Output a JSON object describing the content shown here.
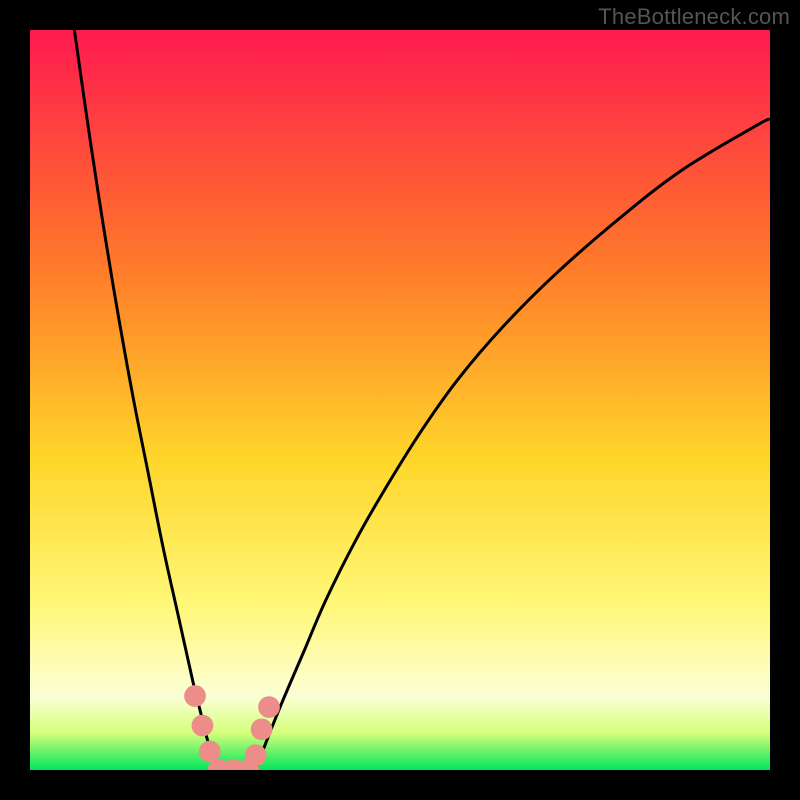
{
  "watermark": "TheBottleneck.com",
  "colors": {
    "frame": "#000000",
    "gradient_top": "#fe1a4e",
    "gradient_mid1": "#ff7a2a",
    "gradient_mid2": "#ffd62a",
    "gradient_mid3": "#fff87a",
    "gradient_mid4": "#fcffd6",
    "gradient_band": "#d4ff7a",
    "gradient_bottom": "#00e65a",
    "line": "#000000",
    "marker": "#ed8d8a"
  },
  "chart_data": {
    "type": "line",
    "title": "",
    "xlabel": "",
    "ylabel": "",
    "xlim": [
      0,
      100
    ],
    "ylim": [
      0,
      100
    ],
    "grid": false,
    "legend": false,
    "series": [
      {
        "name": "left-branch",
        "x": [
          6,
          8,
          10,
          12,
          14,
          16,
          18,
          20,
          22,
          23,
          24,
          25,
          26
        ],
        "y": [
          100,
          86,
          73,
          61,
          50,
          40,
          30,
          21,
          12,
          8,
          4,
          1,
          0
        ]
      },
      {
        "name": "flat-minimum",
        "x": [
          26,
          27,
          28,
          29,
          30,
          30.5
        ],
        "y": [
          0,
          0,
          0,
          0,
          0,
          0
        ]
      },
      {
        "name": "right-branch",
        "x": [
          30.5,
          32,
          34,
          37,
          40,
          44,
          48,
          53,
          58,
          64,
          71,
          79,
          88,
          98,
          100
        ],
        "y": [
          0,
          4,
          9,
          16,
          23,
          31,
          38,
          46,
          53,
          60,
          67,
          74,
          81,
          87,
          88
        ]
      }
    ],
    "annotations": {
      "markers": [
        {
          "x": 22.3,
          "y": 10.0,
          "r": 1.4
        },
        {
          "x": 23.3,
          "y": 6.0,
          "r": 1.4
        },
        {
          "x": 24.3,
          "y": 2.5,
          "r": 1.4
        },
        {
          "x": 25.5,
          "y": 0.0,
          "r": 1.4
        },
        {
          "x": 27.5,
          "y": 0.0,
          "r": 1.4
        },
        {
          "x": 29.5,
          "y": 0.0,
          "r": 1.4
        },
        {
          "x": 30.5,
          "y": 2.0,
          "r": 1.4
        },
        {
          "x": 31.3,
          "y": 5.5,
          "r": 1.4
        },
        {
          "x": 32.3,
          "y": 8.5,
          "r": 1.4
        }
      ]
    }
  }
}
